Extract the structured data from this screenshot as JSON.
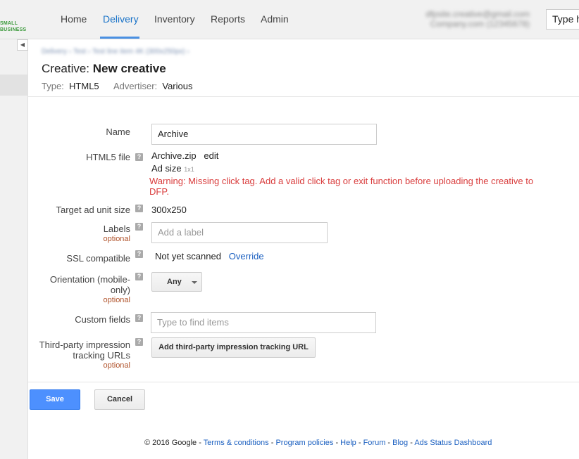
{
  "header": {
    "logo_line1": "SMALL",
    "logo_line2": "BUSINESS",
    "tabs": [
      {
        "label": "Home"
      },
      {
        "label": "Delivery"
      },
      {
        "label": "Inventory"
      },
      {
        "label": "Reports"
      },
      {
        "label": "Admin"
      }
    ],
    "active_tab": "Delivery",
    "account_line1": "dfpsite.creative@gmail.com",
    "account_line2": "Company.com (12345678)",
    "search_placeholder": "Type h"
  },
  "breadcrumb": "Delivery  ›  Test  ›  Test line item 4K (300x250px)  ›",
  "page": {
    "title_prefix": "Creative:",
    "title_name": "New creative",
    "type_label": "Type:",
    "type_value": "HTML5",
    "advertiser_label": "Advertiser:",
    "advertiser_value": "Various"
  },
  "form": {
    "name_label": "Name",
    "name_value": "Archive",
    "html5_label": "HTML5 file",
    "file_name": "Archive.zip",
    "edit_link": "edit",
    "ad_size_label": "Ad size",
    "ad_size_value": "1x1",
    "warning": "Warning: Missing click tag. Add a valid click tag or exit function before uploading the creative to DFP.",
    "target_label": "Target ad unit size",
    "target_value": "300x250",
    "labels_label": "Labels",
    "optional": "optional",
    "labels_placeholder": "Add a label",
    "ssl_label": "SSL compatible",
    "ssl_value": "Not yet scanned",
    "override_link": "Override",
    "orientation_label": "Orientation (mobile-only)",
    "orientation_value": "Any",
    "custom_label": "Custom fields",
    "custom_placeholder": "Type to find items",
    "third_party_label": "Third-party impression tracking URLs",
    "third_party_button": "Add third-party impression tracking URL",
    "help_glyph": "?"
  },
  "actions": {
    "save": "Save",
    "cancel": "Cancel"
  },
  "footer": {
    "copyright": "© 2016 Google",
    "links": [
      "Terms & conditions",
      "Program policies",
      "Help",
      "Forum",
      "Blog",
      "Ads Status Dashboard"
    ],
    "separator": " - "
  },
  "colors": {
    "accent": "#1a73c8",
    "save_button": "#4d90fe",
    "warning": "#d93c3c",
    "optional": "#b0522a"
  }
}
